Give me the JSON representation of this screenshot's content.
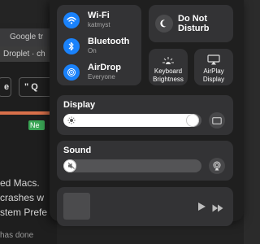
{
  "background": {
    "tab_title": "Google tr",
    "strip_text": "Droplet · ch",
    "toolbar_btn1": "e",
    "toolbar_btn2": "\" Q",
    "new_badge": "Ne",
    "text_lines": [
      "ed Macs.",
      "crashes w",
      "stem Prefe",
      "has done"
    ]
  },
  "control_center": {
    "wifi": {
      "title": "Wi-Fi",
      "subtitle": "katmyst"
    },
    "bluetooth": {
      "title": "Bluetooth",
      "subtitle": "On"
    },
    "airdrop": {
      "title": "AirDrop",
      "subtitle": "Everyone"
    },
    "dnd": {
      "line1": "Do Not",
      "line2": "Disturb"
    },
    "keyboard_brightness": {
      "line1": "Keyboard",
      "line2": "Brightness"
    },
    "airplay_display": {
      "line1": "AirPlay",
      "line2": "Display"
    },
    "display": {
      "title": "Display",
      "level": 0.98
    },
    "sound": {
      "title": "Sound",
      "level": 0.0
    }
  },
  "colors": {
    "accent_blue": "#1a82fb",
    "panel_bg": "#1f1f1f",
    "tile_bg": "#333335"
  }
}
